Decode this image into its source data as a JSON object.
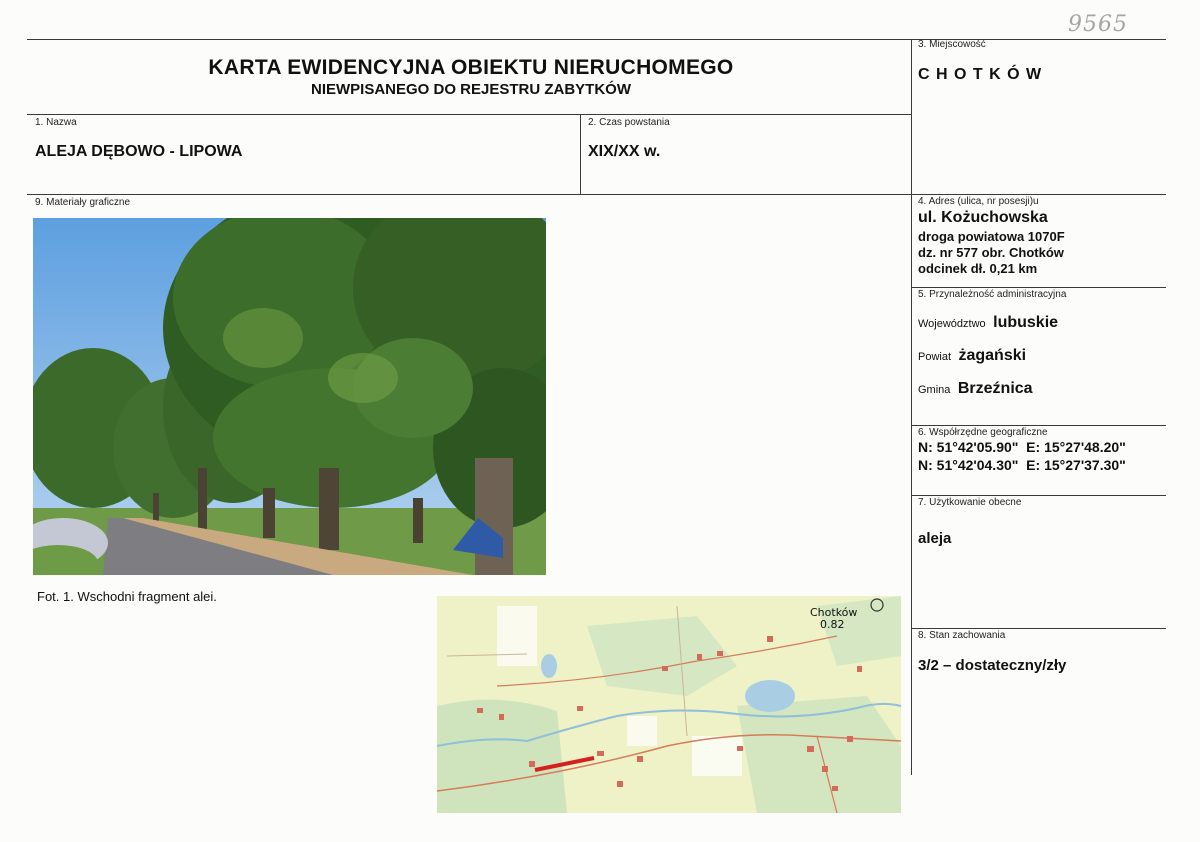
{
  "header": {
    "handwritten_number": "9565",
    "title": "KARTA EWIDENCYJNA OBIEKTU NIERUCHOMEGO",
    "subtitle": "NIEWPISANEGO DO REJESTRU ZABYTKÓW"
  },
  "fields": {
    "nazwa": {
      "label": "1. Nazwa",
      "value": "ALEJA DĘBOWO - LIPOWA"
    },
    "czas": {
      "label": "2. Czas powstania",
      "value": "XIX/XX w."
    },
    "miejscowosc": {
      "label": "3. Miejscowość",
      "value": "C H O T K Ó W"
    },
    "adres": {
      "label": "4. Adres (ulica, nr posesji)u",
      "line1": "ul. Kożuchowska",
      "line2": "droga powiatowa 1070F",
      "line3": "dz. nr 577 obr. Chotków",
      "line4": "odcinek dł. 0,21 km"
    },
    "przynaleznosc": {
      "label": "5. Przynależność administracyjna",
      "woj_label": "Województwo",
      "woj_value": "lubuskie",
      "powiat_label": "Powiat",
      "powiat_value": "żagański",
      "gmina_label": "Gmina",
      "gmina_value": "Brzeźnica"
    },
    "wspolrzedne": {
      "label": "6. Współrzędne geograficzne",
      "row1": "N: 51°42'05.90\"  E: 15°27'48.20\"",
      "row2": "N: 51°42'04.30\"  E: 15°27'37.30\""
    },
    "uzytkowanie": {
      "label": "7. Użytkowanie obecne",
      "value": "aleja"
    },
    "stan": {
      "label": "8. Stan zachowania",
      "value": "3/2 – dostateczny/zły"
    },
    "materialy": {
      "label": "9. Materiały graficzne"
    }
  },
  "photo": {
    "caption": "Fot. 1. Wschodni fragment alei."
  },
  "map": {
    "place_label": "Chotków",
    "place_value": "0.82"
  },
  "colors": {
    "line": "#3a3a3a",
    "road_highlight": "#d81f1f",
    "map_field": "#eef2c6",
    "map_forest": "#cfe4bd",
    "map_water": "#a9cde3"
  }
}
